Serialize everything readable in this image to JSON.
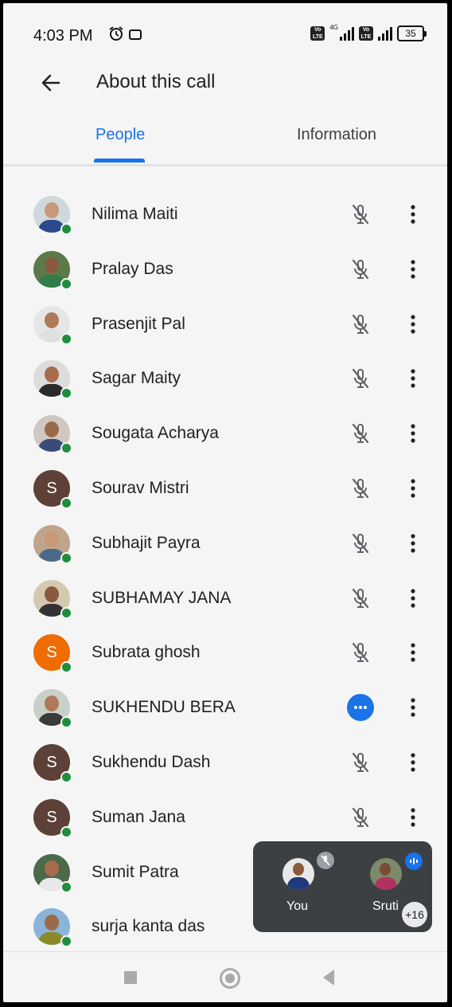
{
  "status_bar": {
    "time": "4:03 PM",
    "network": "4G",
    "battery": "35"
  },
  "app_bar": {
    "title": "About this call",
    "back_icon": "arrow-back-icon"
  },
  "tabs": [
    {
      "label": "People",
      "selected": true
    },
    {
      "label": "Information",
      "selected": false
    }
  ],
  "participants": [
    {
      "name": "Nilima Maiti",
      "avatar": "photo",
      "mic": "muted"
    },
    {
      "name": "Pralay Das",
      "avatar": "photo",
      "mic": "muted"
    },
    {
      "name": "Prasenjit Pal",
      "avatar": "photo",
      "mic": "muted"
    },
    {
      "name": "Sagar Maity",
      "avatar": "photo",
      "mic": "muted"
    },
    {
      "name": "Sougata Acharya",
      "avatar": "photo",
      "mic": "muted"
    },
    {
      "name": "Sourav Mistri",
      "avatar": "letter",
      "initial": "S",
      "color": "#5d4037",
      "mic": "muted"
    },
    {
      "name": "Subhajit Payra",
      "avatar": "photo",
      "mic": "muted"
    },
    {
      "name": "SUBHAMAY JANA",
      "avatar": "photo",
      "mic": "muted"
    },
    {
      "name": "Subrata ghosh",
      "avatar": "letter",
      "initial": "S",
      "color": "#ef6c00",
      "mic": "muted"
    },
    {
      "name": "SUKHENDU BERA",
      "avatar": "photo",
      "mic": "speaking"
    },
    {
      "name": "Sukhendu Dash",
      "avatar": "letter",
      "initial": "S",
      "color": "#5d4037",
      "mic": "muted"
    },
    {
      "name": "Suman Jana",
      "avatar": "letter",
      "initial": "S",
      "color": "#5d4037",
      "mic": "muted"
    },
    {
      "name": "Sumit Patra",
      "avatar": "photo",
      "mic": "hidden"
    },
    {
      "name": "surja kanta das",
      "avatar": "photo",
      "mic": "hidden"
    }
  ],
  "floating_panel": {
    "self_label": "You",
    "other_label": "Sruti",
    "more_count": "+16"
  },
  "colors": {
    "accent": "#1a73e8",
    "online": "#1e8e3e"
  }
}
